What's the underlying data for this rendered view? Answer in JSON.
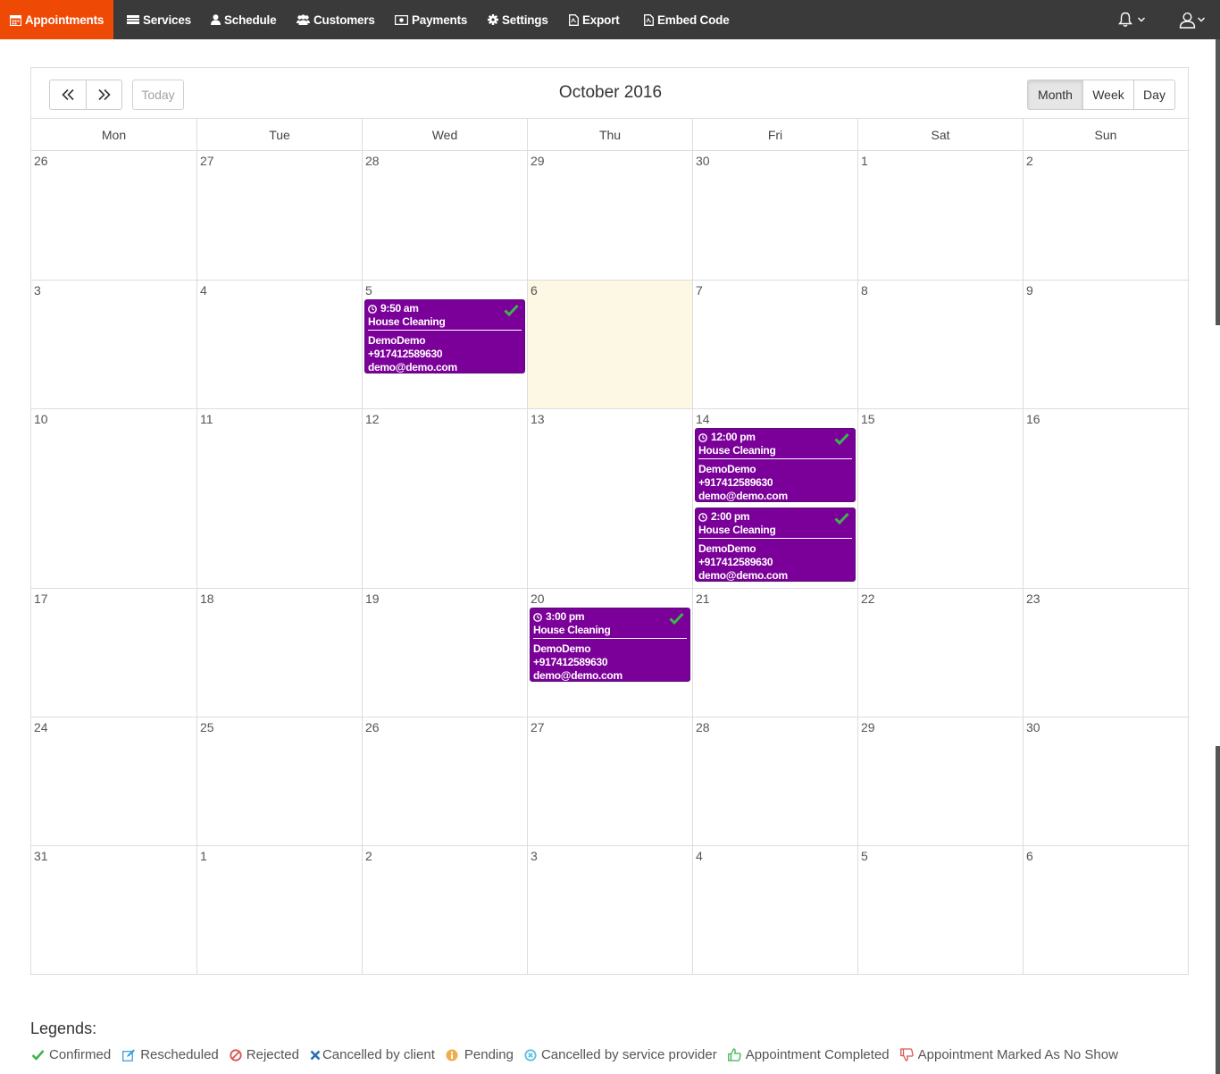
{
  "nav": {
    "items": [
      {
        "label": "Appointments",
        "icon": "calendar-icon",
        "active": true
      },
      {
        "label": "Services",
        "icon": "services-icon"
      },
      {
        "label": "Schedule",
        "icon": "user-icon"
      },
      {
        "label": "Customers",
        "icon": "users-icon"
      },
      {
        "label": "Payments",
        "icon": "money-icon"
      },
      {
        "label": "Settings",
        "icon": "gear-icon"
      },
      {
        "label": "Export",
        "icon": "pdf-icon"
      },
      {
        "label": "Embed Code",
        "icon": "pdf-icon"
      }
    ],
    "accent": "#ee4a06"
  },
  "calendar": {
    "title": "October 2016",
    "today_label": "Today",
    "views": [
      "Month",
      "Week",
      "Day"
    ],
    "active_view": "Month",
    "weekdays": [
      "Mon",
      "Tue",
      "Wed",
      "Thu",
      "Fri",
      "Sat",
      "Sun"
    ],
    "weeks": [
      [
        "26",
        "27",
        "28",
        "29",
        "30",
        "1",
        "2"
      ],
      [
        "3",
        "4",
        "5",
        "6",
        "7",
        "8",
        "9"
      ],
      [
        "10",
        "11",
        "12",
        "13",
        "14",
        "15",
        "16"
      ],
      [
        "17",
        "18",
        "19",
        "20",
        "21",
        "22",
        "23"
      ],
      [
        "24",
        "25",
        "26",
        "27",
        "28",
        "29",
        "30"
      ],
      [
        "31",
        "1",
        "2",
        "3",
        "4",
        "5",
        "6"
      ]
    ],
    "today_date": "6",
    "events": [
      {
        "time": "9:50 am",
        "service": "House Cleaning",
        "name": "DemoDemo",
        "phone": "+917412589630",
        "email": "demo@demo.com",
        "status": "Confirmed"
      },
      {
        "time": "12:00 pm",
        "service": "House Cleaning",
        "name": "DemoDemo",
        "phone": "+917412589630",
        "email": "demo@demo.com",
        "status": "Confirmed"
      },
      {
        "time": "2:00 pm",
        "service": "House Cleaning",
        "name": "DemoDemo",
        "phone": "+917412589630",
        "email": "demo@demo.com",
        "status": "Confirmed"
      },
      {
        "time": "3:00 pm",
        "service": "House Cleaning",
        "name": "DemoDemo",
        "phone": "+917412589630",
        "email": "demo@demo.com",
        "status": "Confirmed"
      }
    ],
    "event_color": "#7b0099"
  },
  "legends": {
    "title": "Legends:",
    "items": [
      {
        "label": "Confirmed",
        "icon": "check-icon",
        "color": "#3cb54a"
      },
      {
        "label": "Rescheduled",
        "icon": "edit-icon",
        "color": "#3a9fd8"
      },
      {
        "label": "Rejected",
        "icon": "ban-icon",
        "color": "#d9534f"
      },
      {
        "label": "Cancelled by client",
        "icon": "times-icon",
        "color": "#2a6fb0"
      },
      {
        "label": "Pending",
        "icon": "info-icon",
        "color": "#f0ad4e"
      },
      {
        "label": "Cancelled by service provider",
        "icon": "times-circle-icon",
        "color": "#5bc0de"
      },
      {
        "label": "Appointment Completed",
        "icon": "thumbs-up-icon",
        "color": "#3cb54a"
      },
      {
        "label": "Appointment Marked As No Show",
        "icon": "thumbs-down-icon",
        "color": "#d9534f"
      }
    ]
  }
}
